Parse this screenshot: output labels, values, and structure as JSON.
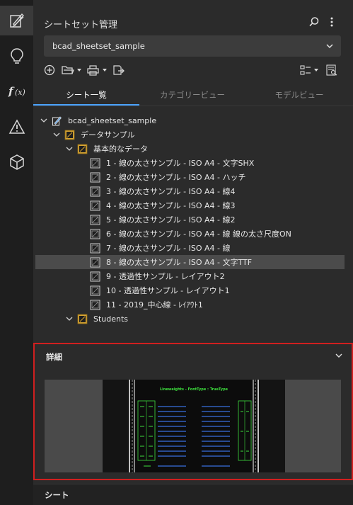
{
  "panel": {
    "title": "シートセット管理",
    "sheetset_selected": "bcad_sheetset_sample"
  },
  "tabs": [
    {
      "label": "シート一覧",
      "active": true
    },
    {
      "label": "カテゴリービュー",
      "active": false
    },
    {
      "label": "モデルビュー",
      "active": false
    }
  ],
  "tree": {
    "root": "bcad_sheetset_sample",
    "group": "データサンプル",
    "subgroup": "基本的なデータ",
    "sheets": [
      "1 - 線の太さサンプル - ISO A4 - 文字SHX",
      "2 - 線の太さサンプル - ISO A4 - ハッチ",
      "3 - 線の太さサンプル - ISO A4 - 線4",
      "4 - 線の太さサンプル - ISO A4 - 線3",
      "5 - 線の太さサンプル - ISO A4 - 線2",
      "6 - 線の太さサンプル - ISO A4 - 線 線の太さ尺度ON",
      "7 - 線の太さサンプル - ISO A4 - 線",
      "8 - 線の太さサンプル - ISO A4 - 文字TTF",
      "9 - 透過性サンプル - レイアウト2",
      "10 - 透過性サンプル - レイアウト1",
      "11 - 2019_中心線 - ﾚｲｱｳﾄ1"
    ],
    "selected_index": 7,
    "students": "Students"
  },
  "detail": {
    "title": "詳細",
    "preview_title": "Lineweights - FontType : TrueType"
  },
  "sheet_section": {
    "label": "シート"
  },
  "colors": {
    "accent": "#4aa3ff",
    "highlight_border": "#d01f1f",
    "selection": "#4b4b4b"
  }
}
